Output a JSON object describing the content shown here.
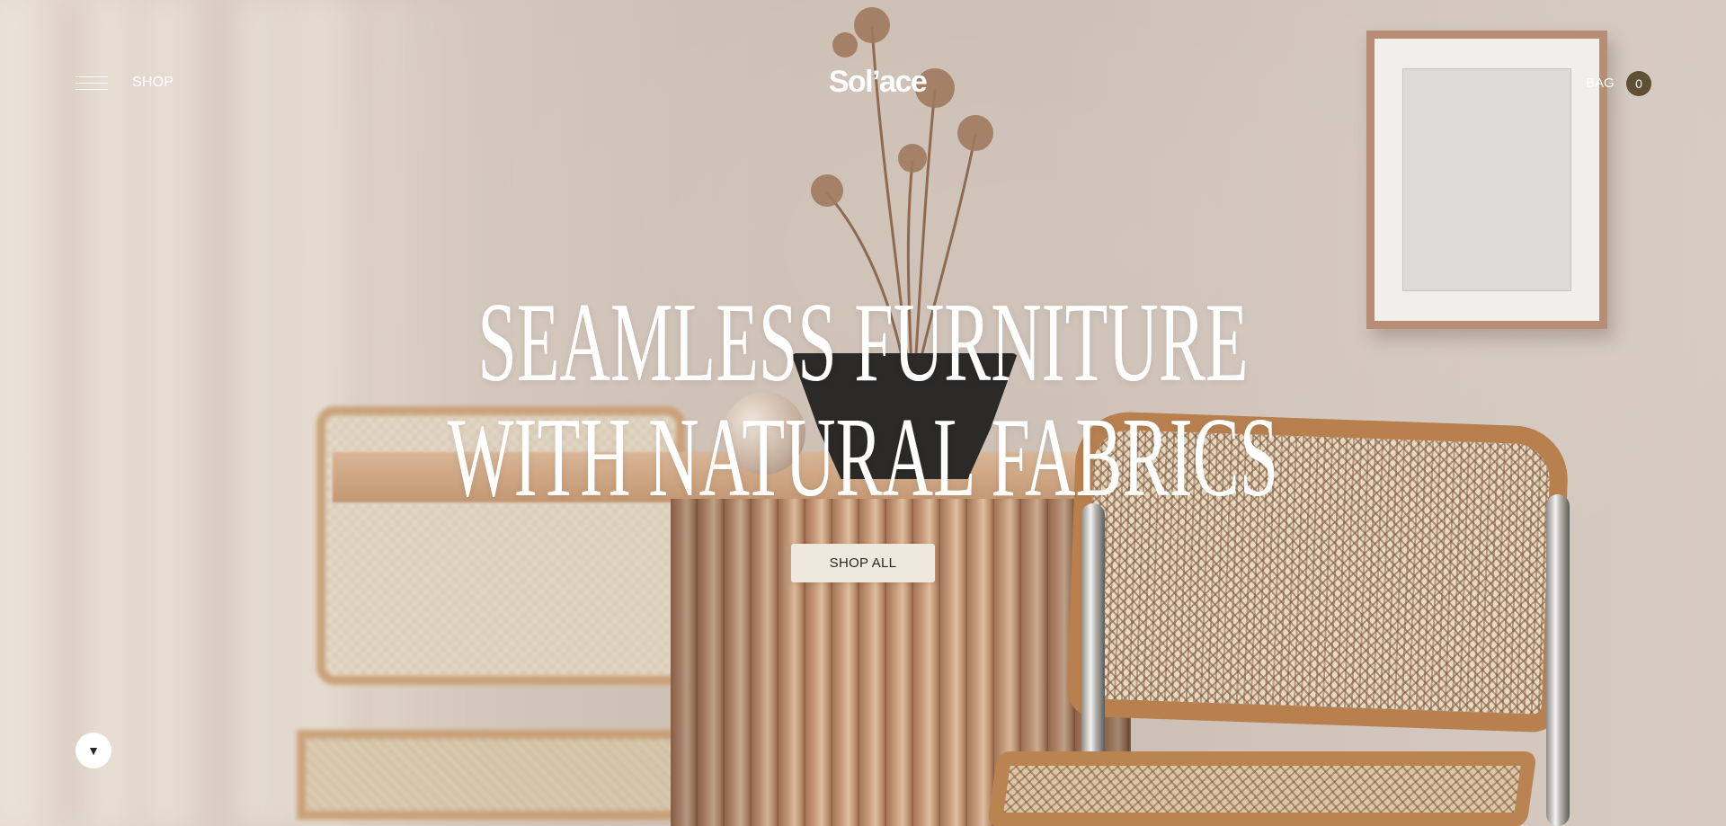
{
  "header": {
    "menu_icon": "hamburger-menu-icon",
    "shop_label": "SHOP",
    "logo": "Sol’ace",
    "bag_label": "BAG",
    "bag_count": "0"
  },
  "hero": {
    "headline_line1": "SEAMLESS FURNITURE",
    "headline_line2": "WITH NATURAL FABRICS",
    "cta_label": "SHOP ALL",
    "scroll_icon": "caret-down-icon",
    "scroll_glyph": "▼"
  },
  "colors": {
    "bag_badge": "#5f4f33",
    "cta_background": "#efe8df",
    "text_light": "#ffffff"
  }
}
